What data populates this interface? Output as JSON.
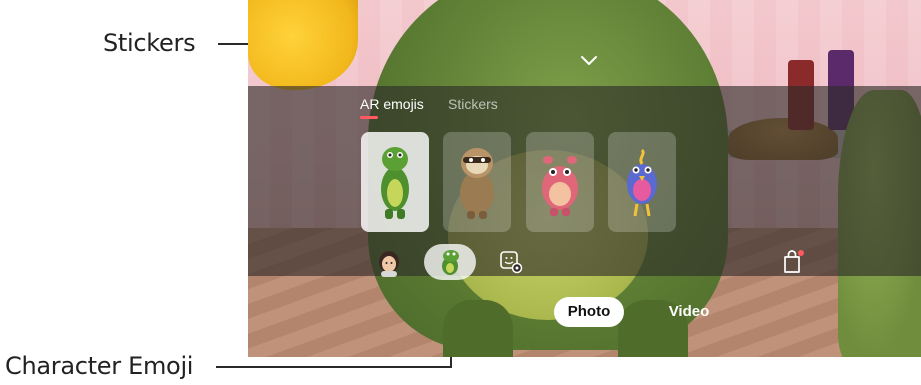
{
  "callouts": {
    "stickers": "Stickers",
    "character_emoji": "Character Emoji"
  },
  "panel": {
    "tabs": [
      {
        "label": "AR emojis",
        "active": true
      },
      {
        "label": "Stickers",
        "active": false
      }
    ],
    "tiles": [
      {
        "icon": "dinosaur-character-icon",
        "selected": true
      },
      {
        "icon": "sloth-character-icon",
        "selected": false
      },
      {
        "icon": "pink-monster-character-icon",
        "selected": false
      },
      {
        "icon": "blue-bird-character-icon",
        "selected": false
      }
    ],
    "bottom_buttons": [
      {
        "icon": "my-emoji-avatar-icon"
      },
      {
        "icon": "character-emoji-dino-icon",
        "selected": true
      },
      {
        "icon": "sticker-settings-icon"
      },
      {
        "icon": "store-bag-icon",
        "has_notification": true
      }
    ]
  },
  "modes": {
    "photo": "Photo",
    "video": "Video",
    "active": "Photo"
  },
  "colors": {
    "tab_indicator": "#ff5a5f",
    "notification_dot": "#ff5a5f",
    "panel_overlay": "rgba(45,42,40,0.62)"
  }
}
